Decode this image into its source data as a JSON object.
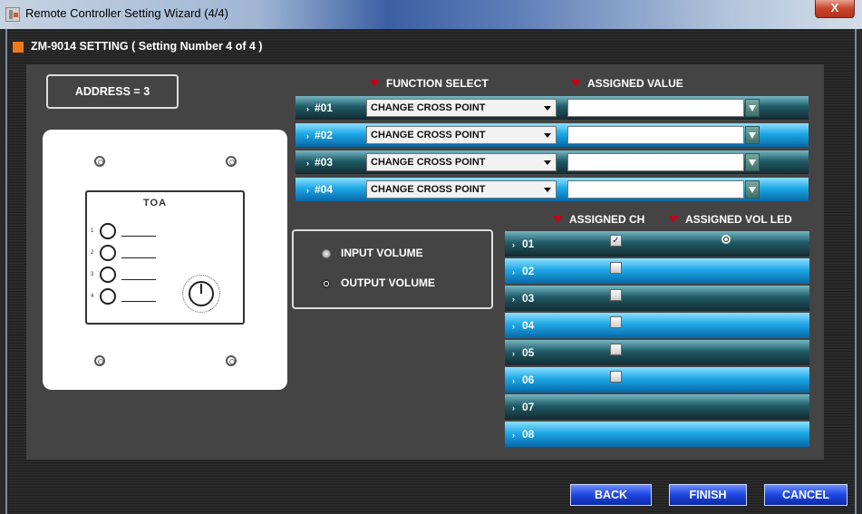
{
  "window": {
    "title": "Remote Controller Setting Wizard (4/4)",
    "close_label": "X"
  },
  "header": {
    "title": "ZM-9014 SETTING   ( Setting Number 4 of 4 )"
  },
  "address": {
    "label": "ADDRESS = 3"
  },
  "device": {
    "brand": "TOA",
    "button_numbers": [
      "1",
      "2",
      "3",
      "4"
    ]
  },
  "columns": {
    "function_select": "FUNCTION SELECT",
    "assigned_value": "ASSIGNED VALUE"
  },
  "functions": [
    {
      "label": "#01",
      "selected": "CHANGE CROSS POINT",
      "value": ""
    },
    {
      "label": "#02",
      "selected": "CHANGE CROSS POINT",
      "value": ""
    },
    {
      "label": "#03",
      "selected": "CHANGE CROSS POINT",
      "value": ""
    },
    {
      "label": "#04",
      "selected": "CHANGE CROSS POINT",
      "value": ""
    }
  ],
  "volume": {
    "input_label": "INPUT VOLUME",
    "output_label": "OUTPUT VOLUME",
    "selected": "output"
  },
  "channel_headers": {
    "assigned_ch": "ASSIGNED CH",
    "assigned_vol_led": "ASSIGNED VOL LED"
  },
  "channels": [
    {
      "label": "01",
      "has_checkbox": true,
      "checked": true,
      "led": true
    },
    {
      "label": "02",
      "has_checkbox": true,
      "checked": false,
      "led": false
    },
    {
      "label": "03",
      "has_checkbox": true,
      "checked": false,
      "led": false
    },
    {
      "label": "04",
      "has_checkbox": true,
      "checked": false,
      "led": false
    },
    {
      "label": "05",
      "has_checkbox": true,
      "checked": false,
      "led": false
    },
    {
      "label": "06",
      "has_checkbox": true,
      "checked": false,
      "led": false
    },
    {
      "label": "07",
      "has_checkbox": false,
      "checked": false,
      "led": false
    },
    {
      "label": "08",
      "has_checkbox": false,
      "checked": false,
      "led": false
    }
  ],
  "buttons": {
    "back": "BACK",
    "finish": "FINISH",
    "cancel": "CANCEL"
  },
  "colors": {
    "accent_orange": "#f07a1a",
    "marker_red": "#c4001a",
    "button_blue": "#1d45e0",
    "row_teal": "#1f5b66",
    "row_blue": "#1ea8e6"
  }
}
